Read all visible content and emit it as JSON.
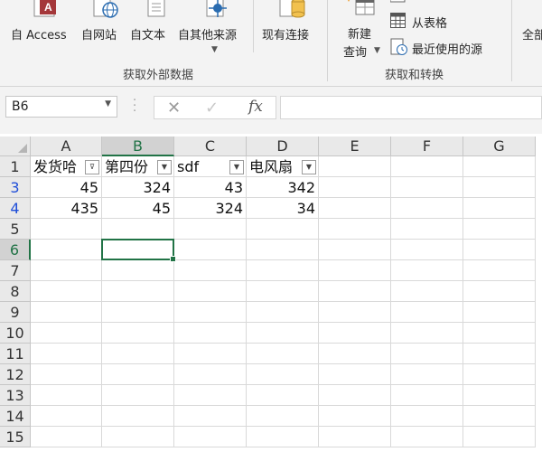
{
  "ribbon": {
    "get_external": {
      "access": "自 Access",
      "web": "自网站",
      "text": "自文本",
      "other": "自其他来源",
      "existing": "现有连接",
      "group_label": "获取外部数据"
    },
    "get_transform": {
      "new_query_line1": "新建",
      "new_query_line2": "查询",
      "from_table": "从表格",
      "recent_sources": "最近使用的源",
      "group_label": "获取和转换"
    },
    "refresh_all": "全部"
  },
  "formula_bar": {
    "name_box": "B6",
    "formula": ""
  },
  "sheet": {
    "columns": [
      "A",
      "B",
      "C",
      "D",
      "E",
      "F",
      "G"
    ],
    "selected_column": "B",
    "rows": [
      {
        "num": "1",
        "cells": [
          "发货哈",
          "第四份",
          "sdf",
          "电风扇",
          "",
          "",
          ""
        ]
      },
      {
        "num": "3",
        "cells": [
          "45",
          "324",
          "43",
          "342",
          "",
          "",
          ""
        ]
      },
      {
        "num": "4",
        "cells": [
          "435",
          "45",
          "324",
          "34",
          "",
          "",
          ""
        ]
      },
      {
        "num": "5",
        "cells": [
          "",
          "",
          "",
          "",
          "",
          "",
          ""
        ]
      },
      {
        "num": "6",
        "cells": [
          "",
          "",
          "",
          "",
          "",
          "",
          ""
        ]
      },
      {
        "num": "7",
        "cells": [
          "",
          "",
          "",
          "",
          "",
          "",
          ""
        ]
      },
      {
        "num": "8",
        "cells": [
          "",
          "",
          "",
          "",
          "",
          "",
          ""
        ]
      },
      {
        "num": "9",
        "cells": [
          "",
          "",
          "",
          "",
          "",
          "",
          ""
        ]
      },
      {
        "num": "10",
        "cells": [
          "",
          "",
          "",
          "",
          "",
          "",
          ""
        ]
      },
      {
        "num": "11",
        "cells": [
          "",
          "",
          "",
          "",
          "",
          "",
          ""
        ]
      },
      {
        "num": "12",
        "cells": [
          "",
          "",
          "",
          "",
          "",
          "",
          ""
        ]
      },
      {
        "num": "13",
        "cells": [
          "",
          "",
          "",
          "",
          "",
          "",
          ""
        ]
      },
      {
        "num": "14",
        "cells": [
          "",
          "",
          "",
          "",
          "",
          "",
          ""
        ]
      },
      {
        "num": "15",
        "cells": [
          "",
          "",
          "",
          "",
          "",
          "",
          ""
        ]
      }
    ],
    "selected_row": "6",
    "filtered_row_colors": {
      "hidden_gap": "#1f4ed8"
    },
    "accent": "#217346"
  }
}
